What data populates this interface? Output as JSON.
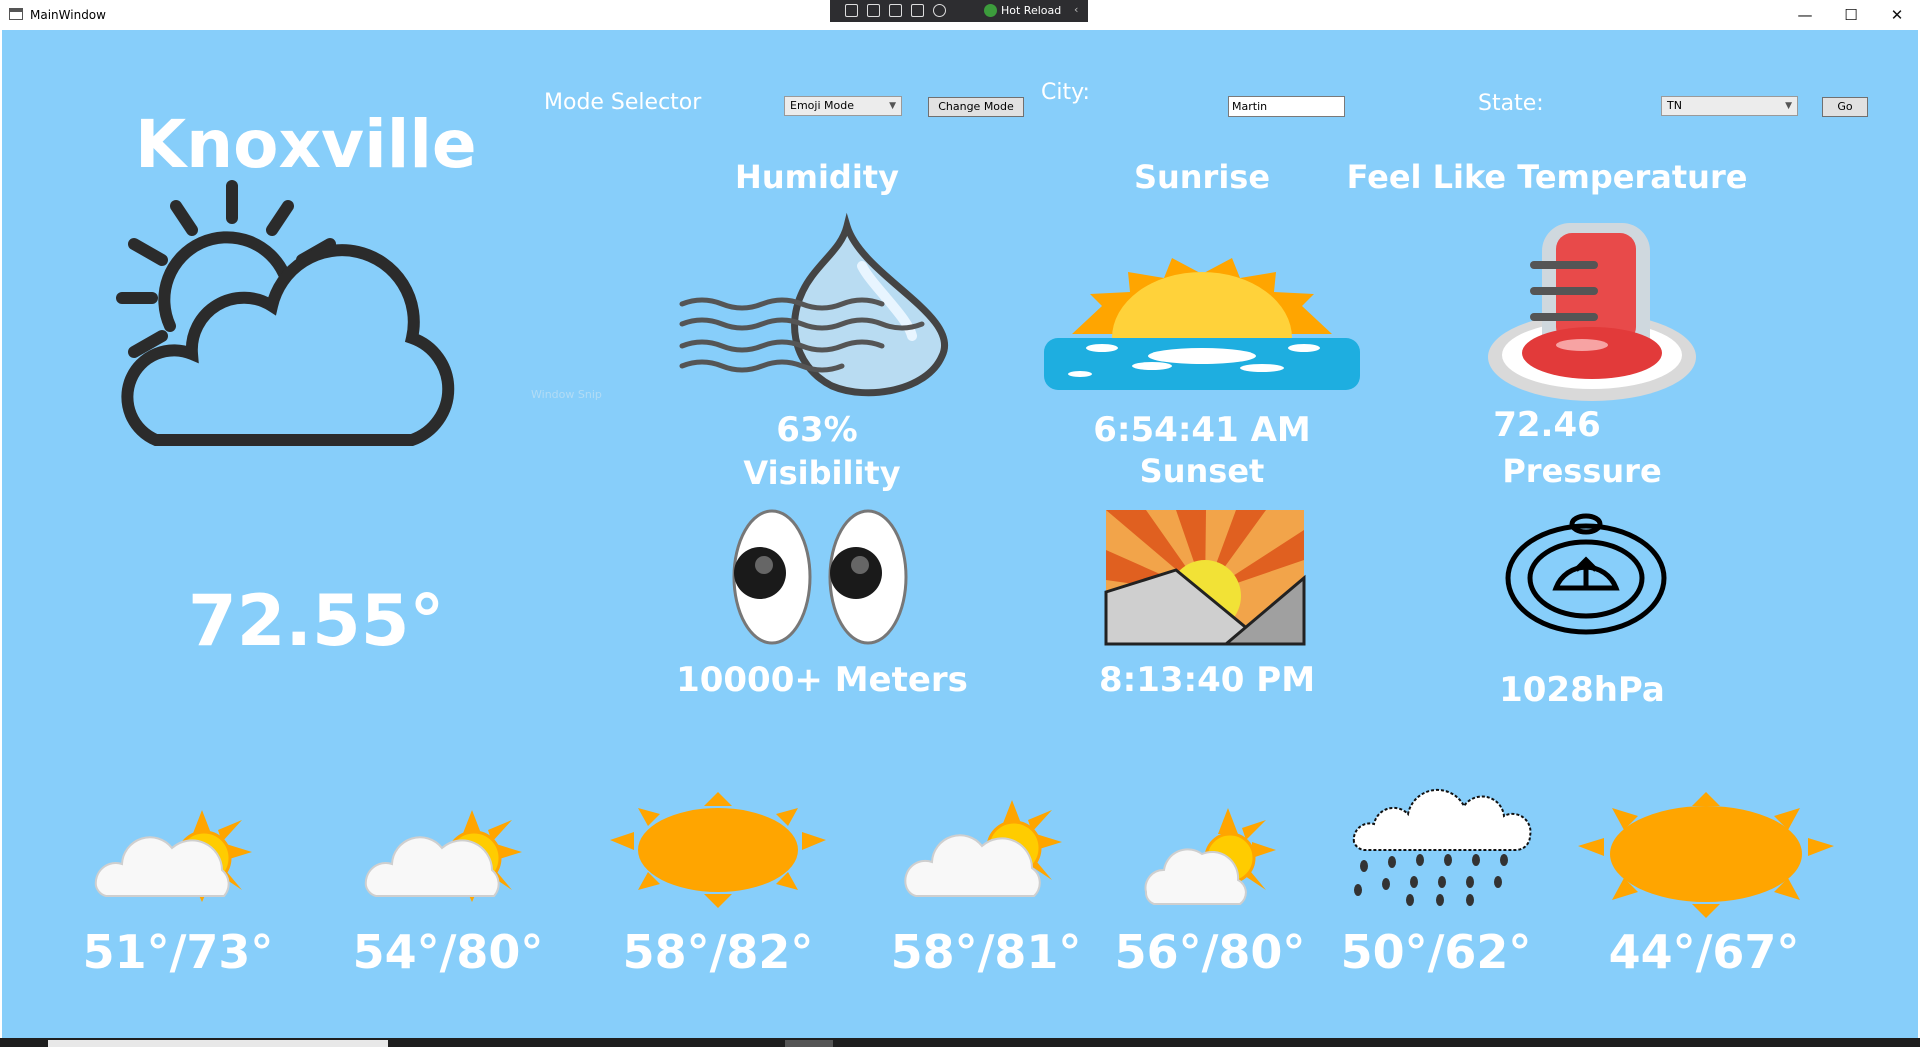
{
  "window": {
    "title": "MainWindow",
    "minimize": "—",
    "maximize": "☐",
    "close": "✕"
  },
  "dev_toolbar": {
    "hot_reload_label": "Hot Reload",
    "chevron": "‹"
  },
  "header": {
    "city_name": "Knoxville",
    "mode_selector_label": "Mode Selector",
    "mode_dropdown_value": "Emoji Mode",
    "change_mode_button": "Change Mode",
    "city_label": "City:",
    "city_input_value": "Martin",
    "state_label": "State:",
    "state_dropdown_value": "TN",
    "go_button": "Go"
  },
  "current": {
    "icon": "partly-cloudy-icon",
    "temperature": "72.55°"
  },
  "details": {
    "humidity": {
      "label": "Humidity",
      "value": "63%",
      "icon": "humidity-droplet-icon"
    },
    "sunrise": {
      "label": "Sunrise",
      "value": "6:54:41 AM",
      "icon": "sunrise-icon"
    },
    "feels_like": {
      "label": "Feel Like Temperature",
      "value": "72.46",
      "icon": "thermometer-icon"
    },
    "visibility": {
      "label": "Visibility",
      "value": "10000+ Meters",
      "icon": "eyes-icon"
    },
    "sunset": {
      "label": "Sunset",
      "value": "8:13:40 PM",
      "icon": "sunset-icon"
    },
    "pressure": {
      "label": "Pressure",
      "value": "1028hPa",
      "icon": "pressure-gauge-icon"
    }
  },
  "ghost_text": "Window Snip",
  "forecast": [
    {
      "range": "51°/73°",
      "icon": "sun-behind-cloud-icon"
    },
    {
      "range": "54°/80°",
      "icon": "sun-behind-cloud-icon"
    },
    {
      "range": "58°/82°",
      "icon": "sun-icon"
    },
    {
      "range": "58°/81°",
      "icon": "sun-behind-cloud-icon"
    },
    {
      "range": "56°/80°",
      "icon": "sun-behind-cloud-icon"
    },
    {
      "range": "50°/62°",
      "icon": "rain-cloud-icon"
    },
    {
      "range": "44°/67°",
      "icon": "sun-icon"
    }
  ],
  "colors": {
    "background": "#87cefa",
    "sun": "#ffa500",
    "text": "#ffffff"
  }
}
